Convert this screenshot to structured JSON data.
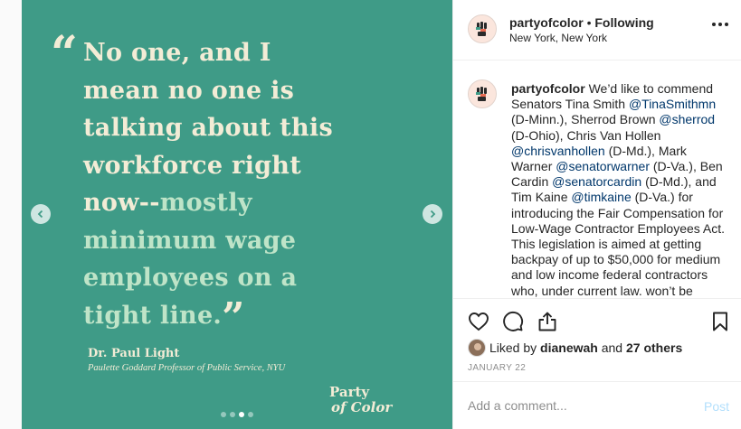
{
  "post": {
    "quote_open": "“",
    "quote_close": "”",
    "quote_lines": [
      {
        "text": "No one, and I",
        "tone": "light"
      },
      {
        "text": "mean no one is",
        "tone": "light"
      },
      {
        "text": "talking about this",
        "tone": "light"
      },
      {
        "text": "workforce right",
        "tone": "light"
      },
      {
        "text_light": "now--",
        "text_mint": "mostly",
        "tone": "split"
      },
      {
        "text": "minimum wage",
        "tone": "mint"
      },
      {
        "text": "employees on a",
        "tone": "mint"
      },
      {
        "text": "tight line.",
        "tone": "mint"
      }
    ],
    "attribution_name": "Dr. Paul Light",
    "attribution_title": "Paulette Goddard Professor of Public Service, NYU",
    "brand_line1": "Party",
    "brand_line2": "of Color",
    "carousel": {
      "total": 4,
      "active_index": 2
    },
    "background_color": "#3f9b87"
  },
  "header": {
    "username": "partyofcolor",
    "separator": " • ",
    "follow_status": "Following",
    "location": "New York, New York",
    "more_icon": "more-horizontal-icon"
  },
  "caption": {
    "username": "partyofcolor",
    "segments": [
      {
        "t": " We’d like to commend Senators Tina Smith "
      },
      {
        "t": "@TinaSmithmn",
        "mention": true
      },
      {
        "t": " (D-Minn.), Sherrod Brown "
      },
      {
        "t": "@sherrod",
        "mention": true
      },
      {
        "t": " (D-Ohio), Chris Van Hollen "
      },
      {
        "t": "@chrisvanhollen",
        "mention": true
      },
      {
        "t": " (D-Md.), Mark Warner "
      },
      {
        "t": "@senatorwarner",
        "mention": true
      },
      {
        "t": " (D-Va.), Ben Cardin "
      },
      {
        "t": "@senatorcardin",
        "mention": true
      },
      {
        "t": " (D-Md.), and Tim Kaine "
      },
      {
        "t": "@timkaine",
        "mention": true
      },
      {
        "t": " (D-Va.) for introducing the Fair Compensation for Low-Wage Contractor Employees Act. This legislation is aimed at getting backpay of up to $50,000 for medium and low income federal contractors who, under current law. won’t be reimbursed for"
      }
    ]
  },
  "actions": {
    "icons": [
      "heart-icon",
      "comment-icon",
      "share-icon",
      "bookmark-icon"
    ],
    "liked_by_prefix": "Liked by ",
    "liked_by_user": "dianewah",
    "liked_by_and": " and ",
    "others": "27 others",
    "date": "JANUARY 22"
  },
  "comment": {
    "placeholder": "Add a comment...",
    "post_label": "Post"
  },
  "colors": {
    "mention": "#00376b",
    "post_disabled": "#b2dffc",
    "quote_light": "#f3ecd6",
    "quote_mint": "#bfe4c8"
  }
}
